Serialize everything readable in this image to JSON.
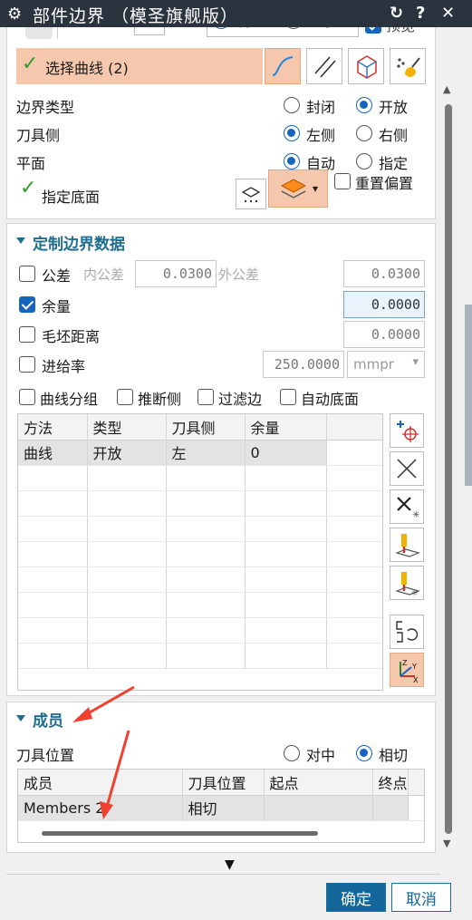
{
  "window": {
    "title": "部件边界 （模圣旗舰版）",
    "buttons": [
      "↻",
      "?",
      "✕"
    ]
  },
  "top_partial": {
    "radio1": "设置",
    "radio2": "继承",
    "preview": "预览"
  },
  "selection": {
    "select_curve": "选择曲线 (2)",
    "boundary_type_label": "边界类型",
    "boundary_type_options": [
      "封闭",
      "开放"
    ],
    "tool_side_label": "刀具侧",
    "tool_side_options": [
      "左侧",
      "右侧"
    ],
    "plane_label": "平面",
    "plane_options": [
      "自动",
      "指定"
    ],
    "specify_floor": "指定底面",
    "reset_offset": "重置偏置"
  },
  "custom_data": {
    "section_title": "定制边界数据",
    "tolerance_label": "公差",
    "inner_tol_label": "内公差",
    "inner_tol_value": "0.0300",
    "outer_tol_label": "外公差",
    "outer_tol_value": "0.0300",
    "stock_label": "余量",
    "stock_value": "0.0000",
    "blank_dist_label": "毛坯距离",
    "blank_dist_value": "0.0000",
    "feed_label": "进给率",
    "feed_value": "250.0000",
    "feed_unit": "mmpr",
    "options": [
      "曲线分组",
      "推断侧",
      "过滤边",
      "自动底面"
    ],
    "table_headers": [
      "方法",
      "类型",
      "刀具侧",
      "余量"
    ],
    "table_rows": [
      [
        "曲线",
        "开放",
        "左",
        "0"
      ]
    ]
  },
  "members": {
    "section_title": "成员",
    "tool_pos_label": "刀具位置",
    "tool_pos_options": [
      "对中",
      "相切"
    ],
    "table_headers": [
      "成员",
      "刀具位置",
      "起点",
      "终点"
    ],
    "table_rows": [
      [
        "Members 2",
        "相切",
        "",
        ""
      ]
    ]
  },
  "footer": {
    "ok": "确定",
    "cancel": "取消"
  },
  "colors": {
    "accent": "#1565c0",
    "titlebar": "#2b333f",
    "section": "#1f6d8f",
    "selected_btn": "#f5c7ad",
    "check_green": "#2e9e2e",
    "annotation_arrow": "#f04030"
  }
}
